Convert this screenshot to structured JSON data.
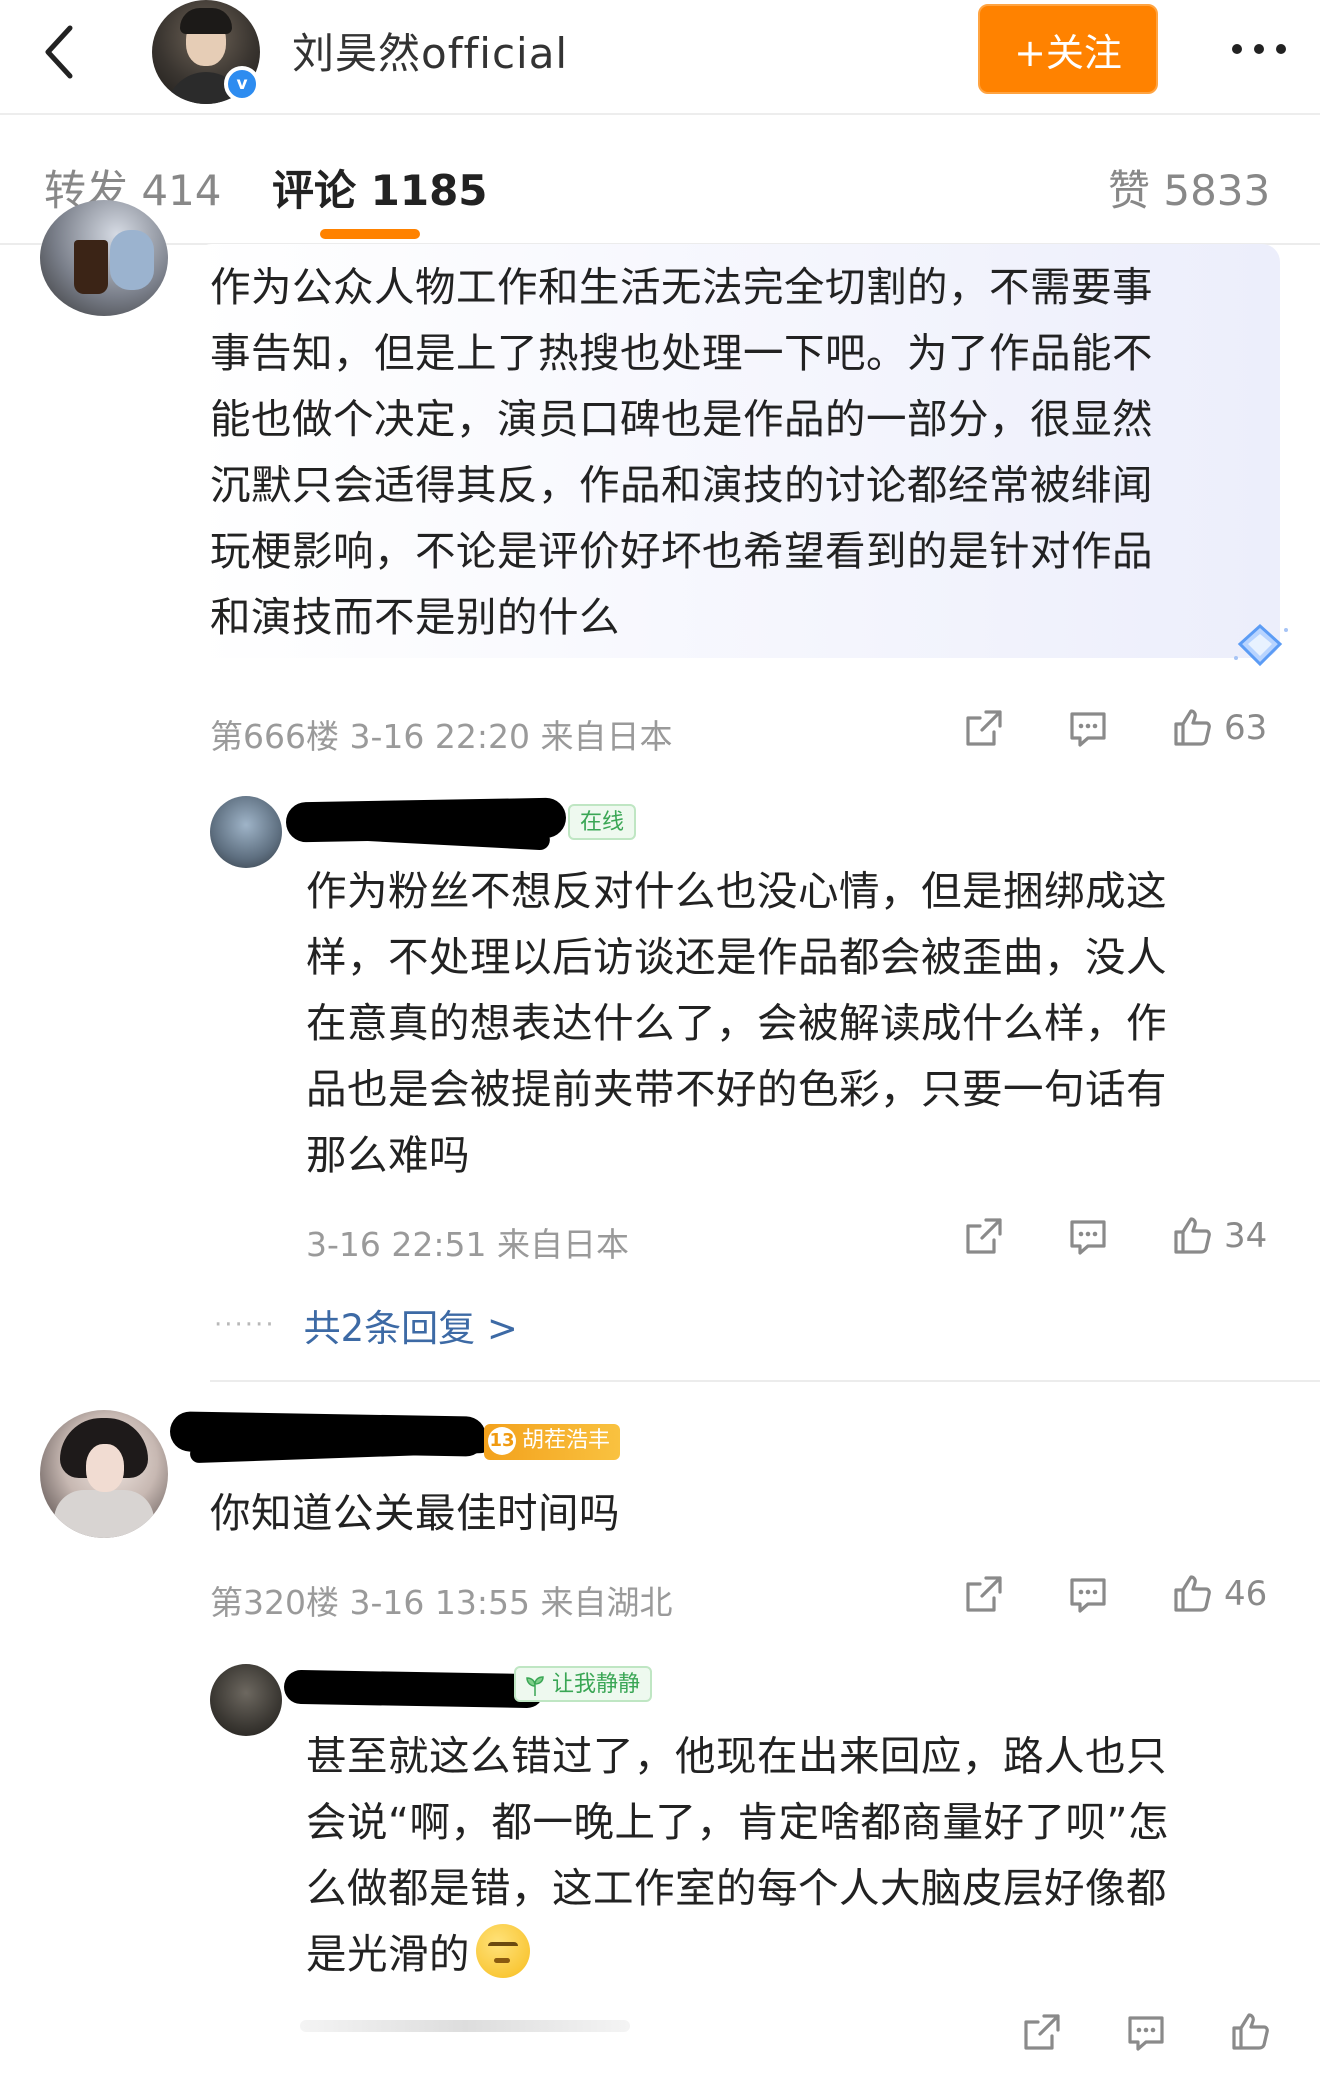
{
  "header": {
    "title": "刘昊然official",
    "follow_label": "+关注",
    "verified_mark": "v"
  },
  "tabs": {
    "forward": "转发 414",
    "comments": "评论 1185",
    "likes": "赞 5833"
  },
  "colors": {
    "accent": "#ff8200",
    "link": "#3d6aa5",
    "meta": "#9a9a9a",
    "online_tag": "#3aa655"
  },
  "comments": [
    {
      "text": "作为公众人物工作和生活无法完全切割的，不需要事\n事告知，但是上了热搜也处理一下吧。为了作品能不\n能也做个决定，演员口碑也是作品的一部分，很显然\n沉默只会适得其反，作品和演技的讨论都经常被绯闻\n玩梗影响，不论是评价好坏也希望看到的是针对作品\n和演技而不是别的什么",
      "meta": "第666楼 3-16 22:20 来自日本",
      "likes": "63"
    },
    {
      "tag": "在线",
      "text": "作为粉丝不想反对什么也没心情，但是捆绑成这\n样，不处理以后访谈还是作品都会被歪曲，没人\n在意真的想表达什么了，会被解读成什么样，作\n品也是会被提前夹带不好的色彩，只要一句话有\n那么难吗",
      "meta": "3-16 22:51 来自日本",
      "likes": "34",
      "more_replies": "共2条回复 >",
      "dots": "······"
    },
    {
      "fan_level": "13",
      "tag": "胡茬浩丰",
      "text": "你知道公关最佳时间吗",
      "meta": "第320楼 3-16 13:55 来自湖北",
      "likes": "46"
    },
    {
      "tag": "让我静静",
      "text": "甚至就这么错过了，他现在出来回应，路人也只\n会说“啊，都一晚上了，肯定啥都商量好了呗”怎\n么做都是错，这工作室的每个人大脑皮层好像都\n是光滑的"
    }
  ]
}
